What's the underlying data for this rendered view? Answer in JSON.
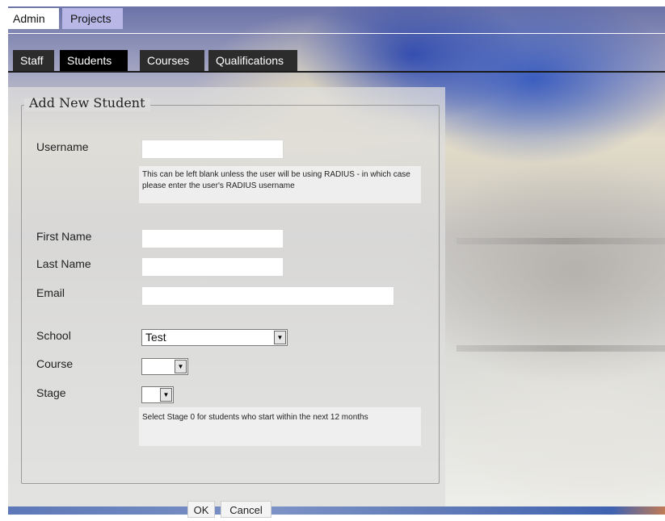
{
  "top_tabs": [
    {
      "label": "Admin"
    },
    {
      "label": "Projects"
    }
  ],
  "sub_tabs": [
    {
      "label": "Staff"
    },
    {
      "label": "Students"
    },
    {
      "label": "Courses"
    },
    {
      "label": "Qualifications"
    }
  ],
  "form": {
    "legend": "Add New Student",
    "username_label": "Username",
    "username_value": "",
    "username_help": "This can be left blank unless the user will be using RADIUS - in which case please enter the user's RADIUS username",
    "first_name_label": "First Name",
    "first_name_value": "",
    "last_name_label": "Last Name",
    "last_name_value": "",
    "email_label": "Email",
    "email_value": "",
    "school_label": "School",
    "school_value": "Test",
    "course_label": "Course",
    "course_value": "",
    "stage_label": "Stage",
    "stage_value": "",
    "stage_help": "Select Stage 0 for students who start within the next 12 months"
  },
  "buttons": {
    "ok": "OK",
    "cancel": "Cancel"
  },
  "colors": {
    "active_top_tab": "#ffffff",
    "inactive_top_tab": "#b8b7e6",
    "active_sub_tab": "#000000",
    "inactive_sub_tab": "#2c2c2c"
  }
}
